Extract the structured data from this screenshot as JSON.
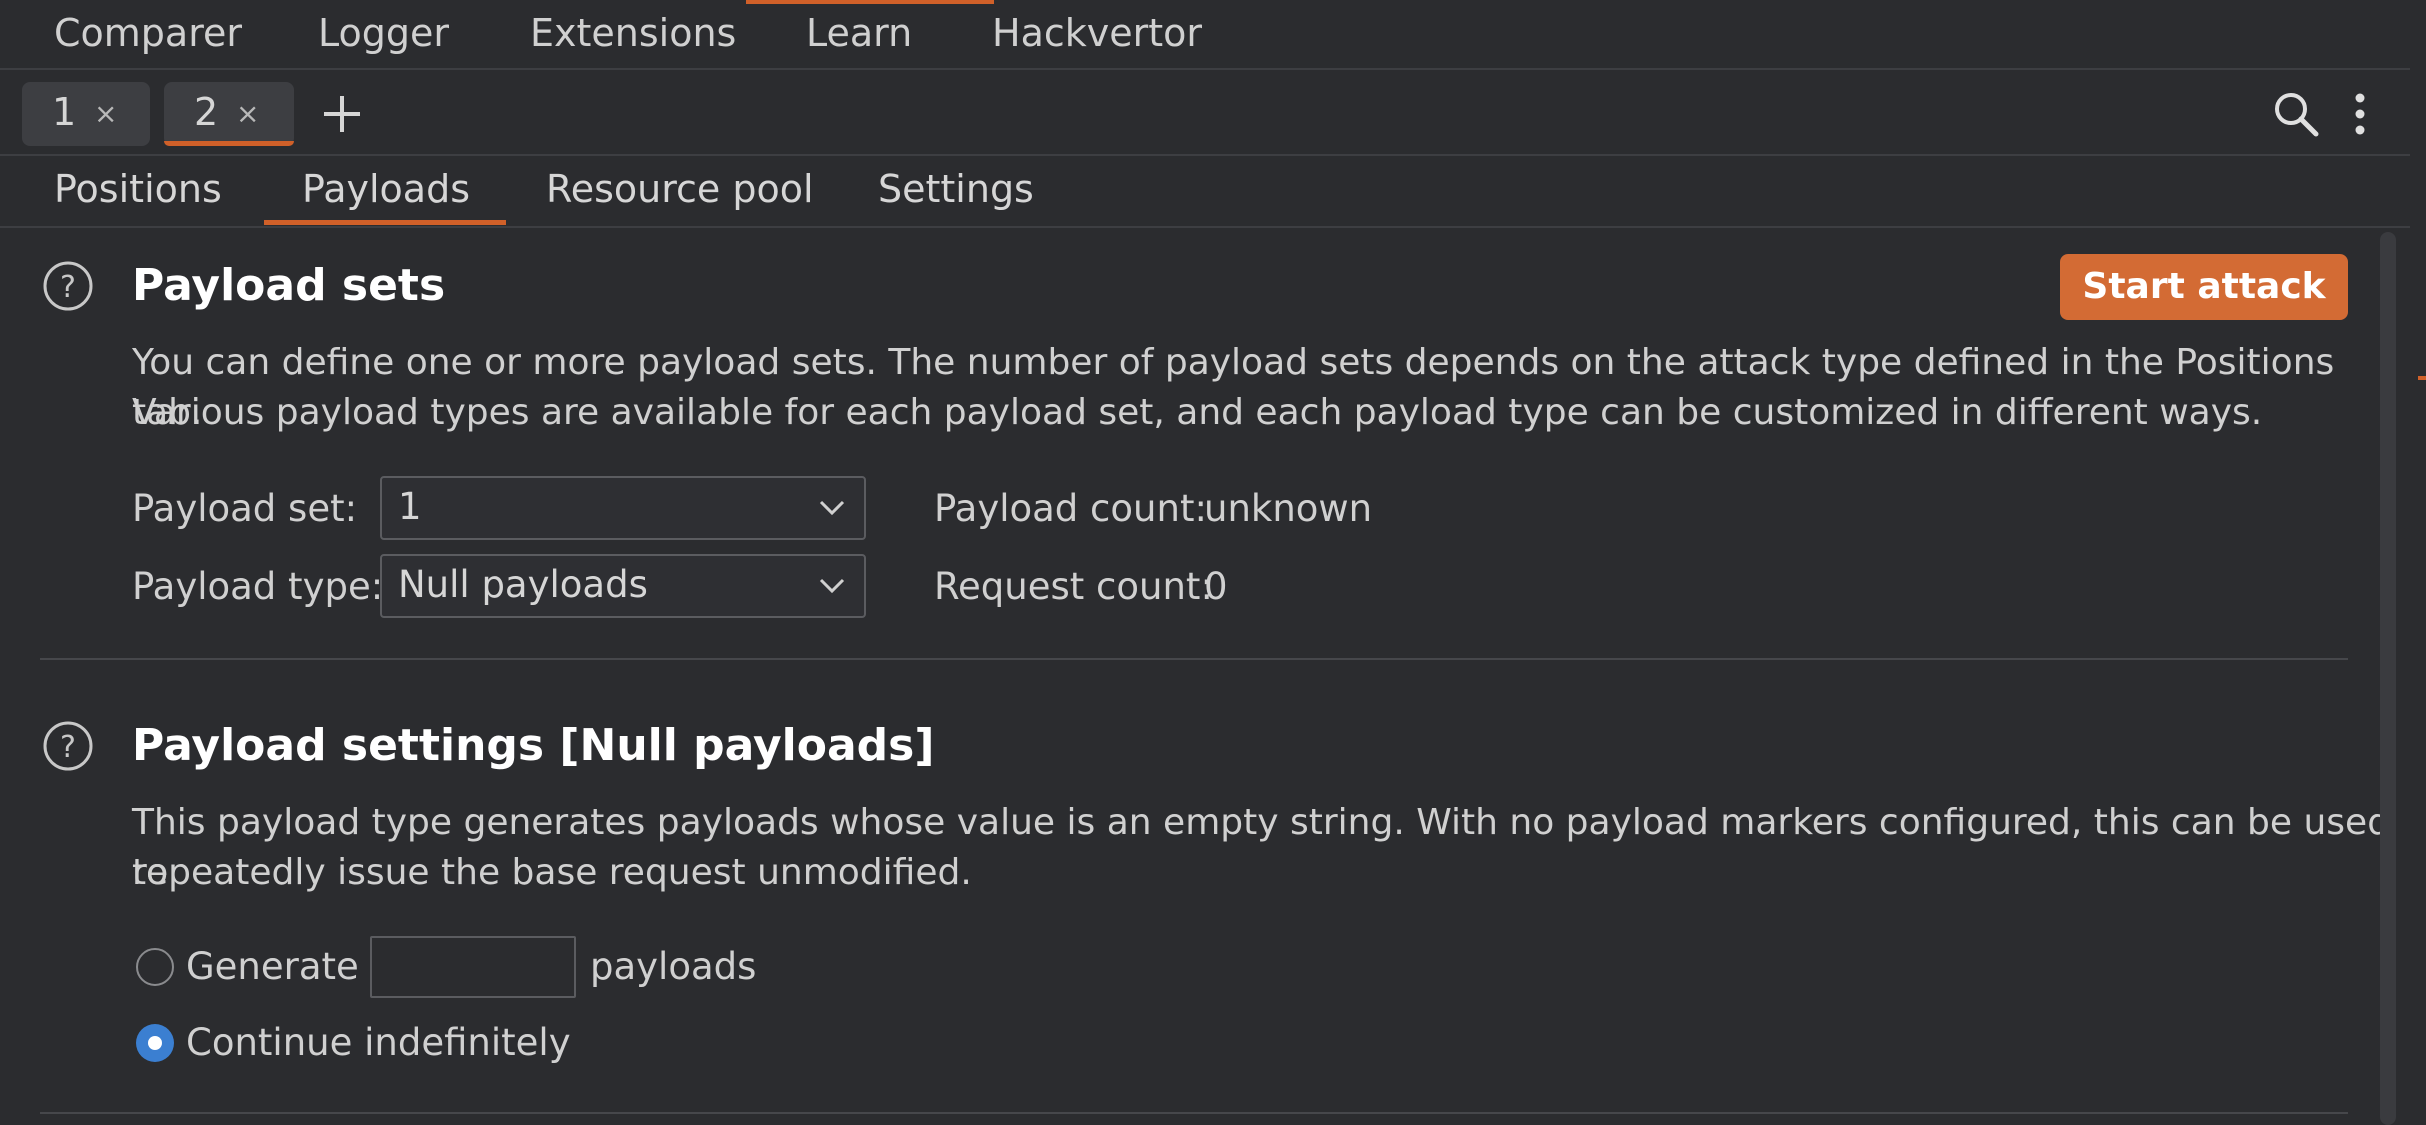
{
  "top_nav": {
    "items": [
      "Comparer",
      "Logger",
      "Extensions",
      "Learn",
      "Hackvertor"
    ]
  },
  "intruder_tabs": [
    {
      "label": "1",
      "close": "×",
      "active": false
    },
    {
      "label": "2",
      "close": "×",
      "active": true
    }
  ],
  "icons": {
    "add_tab": "plus-icon",
    "search": "search-icon",
    "more": "more-vertical-icon",
    "help": "question-circle-icon",
    "dropdown": "chevron-down-icon"
  },
  "sub_tabs": {
    "items": [
      "Positions",
      "Payloads",
      "Resource pool",
      "Settings"
    ],
    "active": "Payloads"
  },
  "payload_sets": {
    "title": "Payload sets",
    "start_attack_label": "Start attack",
    "description_line1": "You can define one or more payload sets. The number of payload sets depends on the attack type defined in the Positions tab.",
    "description_line2": "Various payload types are available for each payload set, and each payload type can be customized in different ways.",
    "payload_set_label": "Payload set:",
    "payload_set_value": "1",
    "payload_type_label": "Payload type:",
    "payload_type_value": "Null payloads",
    "payload_count_label": "Payload count:",
    "payload_count_value": "unknown",
    "request_count_label": "Request count:",
    "request_count_value": "0"
  },
  "payload_settings": {
    "title": "Payload settings [Null payloads]",
    "description_line1": "This payload type generates payloads whose value is an empty string. With no payload markers configured, this can be used to",
    "description_line2": "repeatedly issue the base request unmodified.",
    "generate_label": "Generate",
    "generate_value": "",
    "payloads_suffix": "payloads",
    "continue_label": "Continue indefinitely",
    "selected_option": "Continue indefinitely"
  },
  "colors": {
    "accent": "#d06029",
    "button": "#d36b34",
    "radio_selected": "#3b7fd1",
    "background": "#2b2c2f"
  }
}
